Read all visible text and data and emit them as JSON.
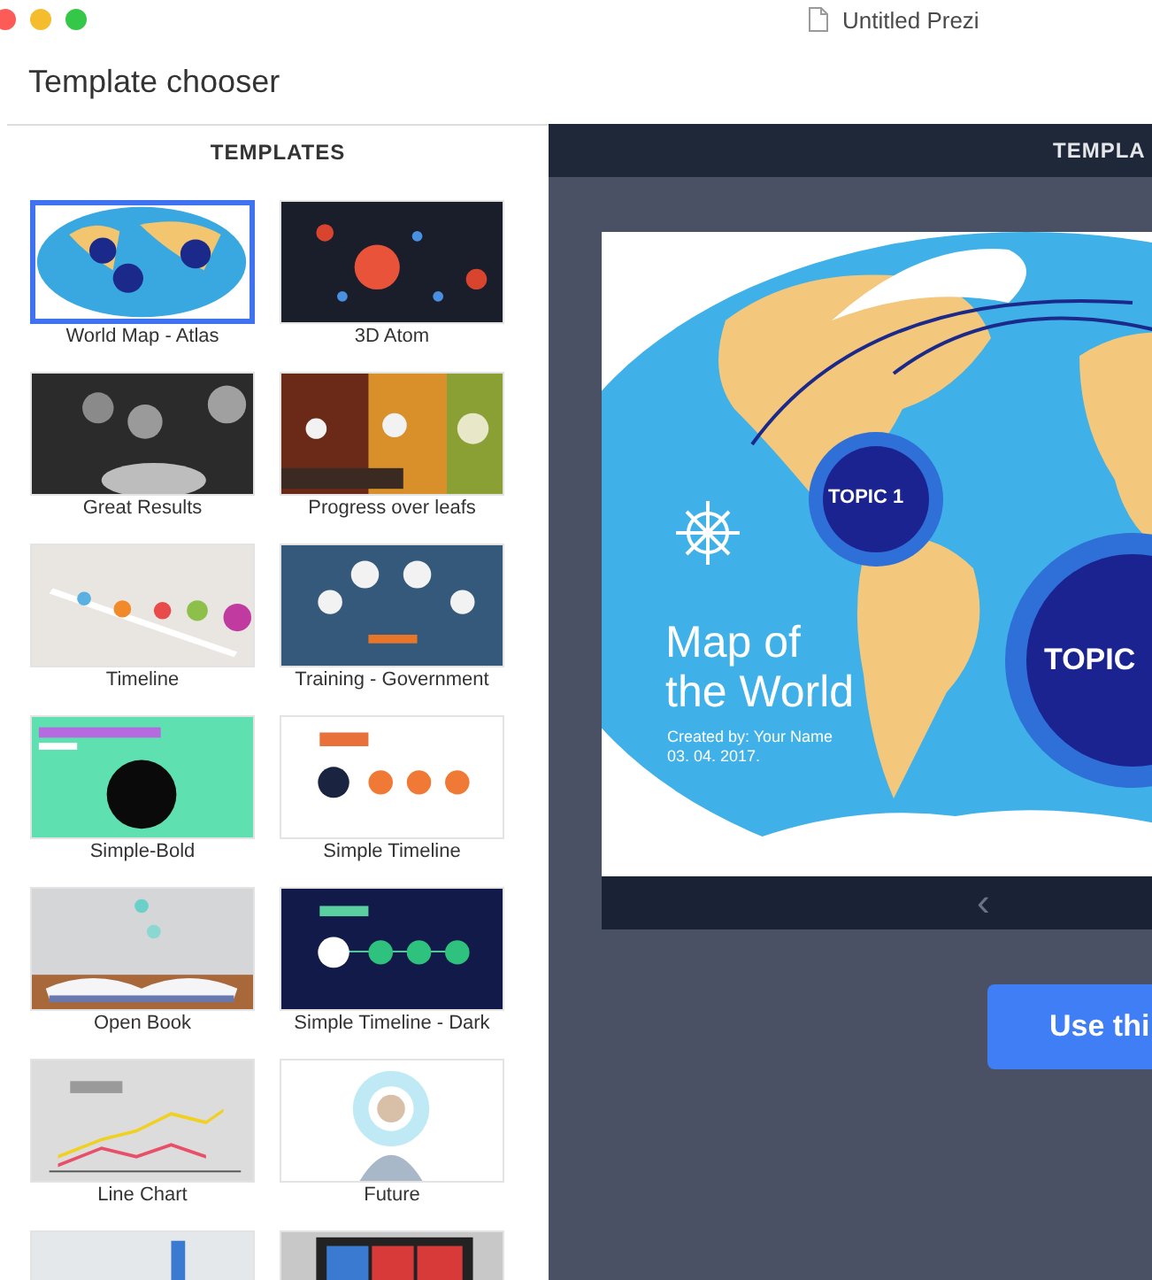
{
  "window": {
    "title": "Untitled Prezi"
  },
  "header": {
    "title": "Template chooser"
  },
  "templates_panel": {
    "heading": "TEMPLATES",
    "items": [
      {
        "label": "World Map - Atlas",
        "selected": true
      },
      {
        "label": "3D Atom",
        "selected": false
      },
      {
        "label": "Great Results",
        "selected": false
      },
      {
        "label": "Progress over leafs",
        "selected": false
      },
      {
        "label": "Timeline",
        "selected": false
      },
      {
        "label": "Training - Government",
        "selected": false
      },
      {
        "label": "Simple-Bold",
        "selected": false
      },
      {
        "label": "Simple Timeline",
        "selected": false
      },
      {
        "label": "Open Book",
        "selected": false
      },
      {
        "label": "Simple Timeline - Dark",
        "selected": false
      },
      {
        "label": "Line Chart",
        "selected": false
      },
      {
        "label": "Future",
        "selected": false
      },
      {
        "selected": false
      },
      {
        "selected": false
      }
    ]
  },
  "preview": {
    "heading": "TEMPLA",
    "slide": {
      "topic_1": "TOPIC 1",
      "topic_2": "TOPIC",
      "title": "Map of the World",
      "subtitle": [
        "Created by: Your Name",
        "03. 04. 2017."
      ]
    },
    "nav_prev": "‹",
    "use_button": "Use thi"
  }
}
